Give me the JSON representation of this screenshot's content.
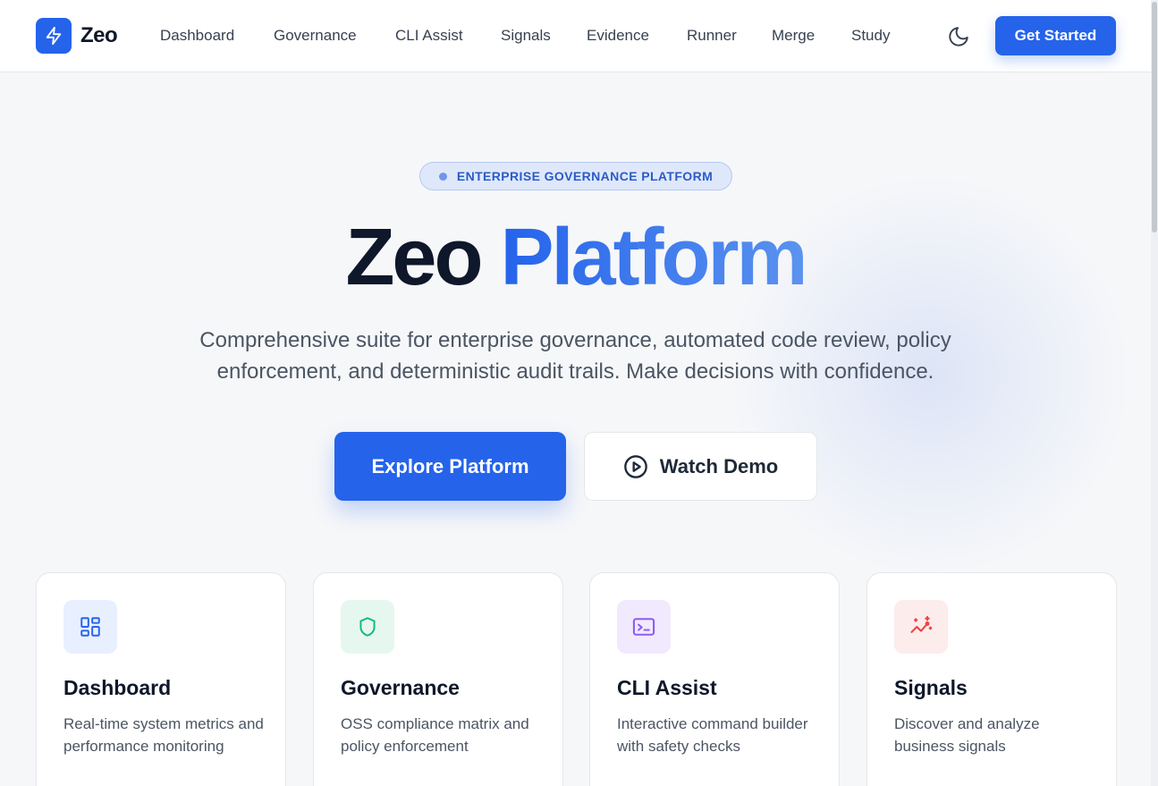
{
  "brand": {
    "name": "Zeo",
    "icon": "lightning-bolt-icon",
    "color": "#2563eb"
  },
  "nav": {
    "links": [
      "Dashboard",
      "Governance",
      "CLI Assist",
      "Signals",
      "Evidence",
      "Runner",
      "Merge",
      "Study"
    ],
    "theme_toggle_icon": "moon-icon",
    "cta_label": "Get Started"
  },
  "hero": {
    "badge": "ENTERPRISE GOVERNANCE PLATFORM",
    "title_dark": "Zeo",
    "title_accent": "Platform",
    "subtitle_line1": "Comprehensive suite for enterprise governance, automated code review, policy",
    "subtitle_line2": "enforcement, and deterministic audit trails. Make decisions with confidence.",
    "primary_button": "Explore Platform",
    "secondary_button": "Watch Demo",
    "secondary_icon": "play-circle-icon"
  },
  "features": [
    {
      "title": "Dashboard",
      "description": "Real-time system metrics and performance monitoring",
      "icon": "dashboard-grid-icon",
      "accent": "#2563eb",
      "bg": "#e8efff"
    },
    {
      "title": "Governance",
      "description": "OSS compliance matrix and policy enforcement",
      "icon": "shield-icon",
      "accent": "#10b981",
      "bg": "#e6f7f0"
    },
    {
      "title": "CLI Assist",
      "description": "Interactive command builder with safety checks",
      "icon": "terminal-icon",
      "accent": "#8b5cf6",
      "bg": "#f1eafe"
    },
    {
      "title": "Signals",
      "description": "Discover and analyze business signals",
      "icon": "trend-sparkle-icon",
      "accent": "#ef4444",
      "bg": "#fdecec"
    }
  ]
}
